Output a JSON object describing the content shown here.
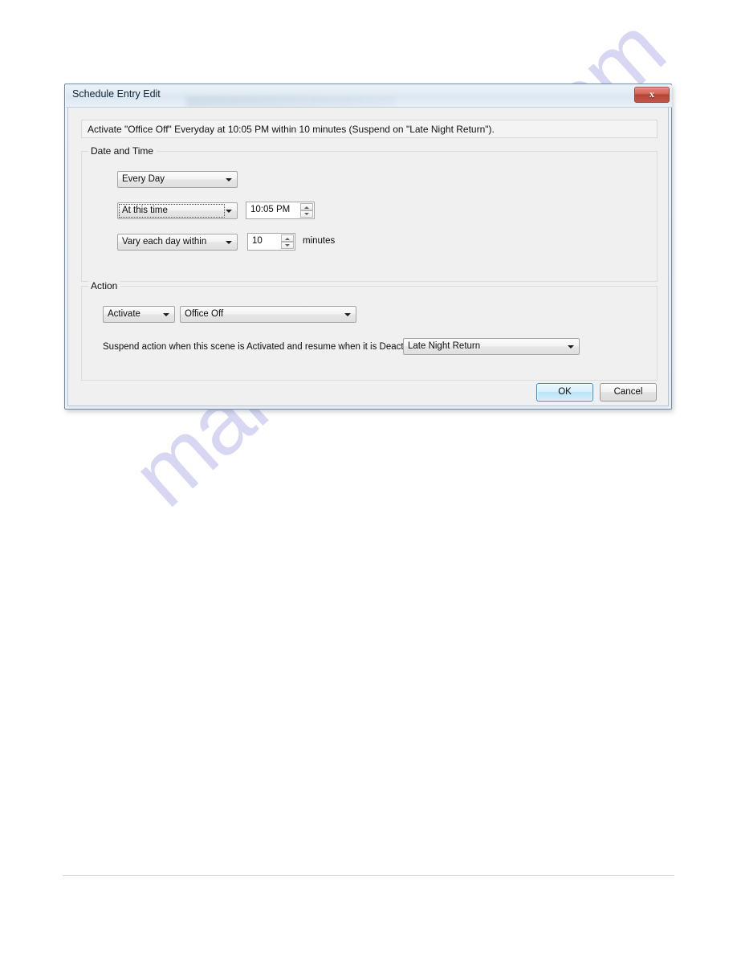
{
  "window": {
    "title": "Schedule Entry Edit",
    "close_label": "x",
    "close_icon": "close-icon"
  },
  "summary": {
    "text": "Activate \"Office Off\" Everyday at 10:05 PM within 10 minutes (Suspend on \"Late Night Return\")."
  },
  "date_and_time": {
    "legend": "Date and Time",
    "recurrence": {
      "value": "Every Day"
    },
    "time_mode": {
      "value": "At this time",
      "focused": true
    },
    "time_value": {
      "value": "10:05 PM"
    },
    "vary_mode": {
      "value": "Vary each day within"
    },
    "vary_minutes": {
      "value": "10"
    },
    "minutes_label": "minutes"
  },
  "action": {
    "legend": "Action",
    "action_type": {
      "value": "Activate"
    },
    "scene": {
      "value": "Office Off"
    },
    "suspend_label": "Suspend action when this scene is Activated and resume when it is Deactivated:",
    "suspend_scene": {
      "value": "Late Night Return"
    }
  },
  "footer": {
    "ok_label": "OK",
    "cancel_label": "Cancel"
  },
  "page": {
    "watermark": "manualshive.com"
  },
  "colors": {
    "accent": "#2e8fcd",
    "close_button": "#b64435",
    "dialog_background": "#f0f0f0",
    "titlebar": "#e3ecf5",
    "watermark": "#c9c9ef",
    "rule": "#d2d2d2"
  }
}
